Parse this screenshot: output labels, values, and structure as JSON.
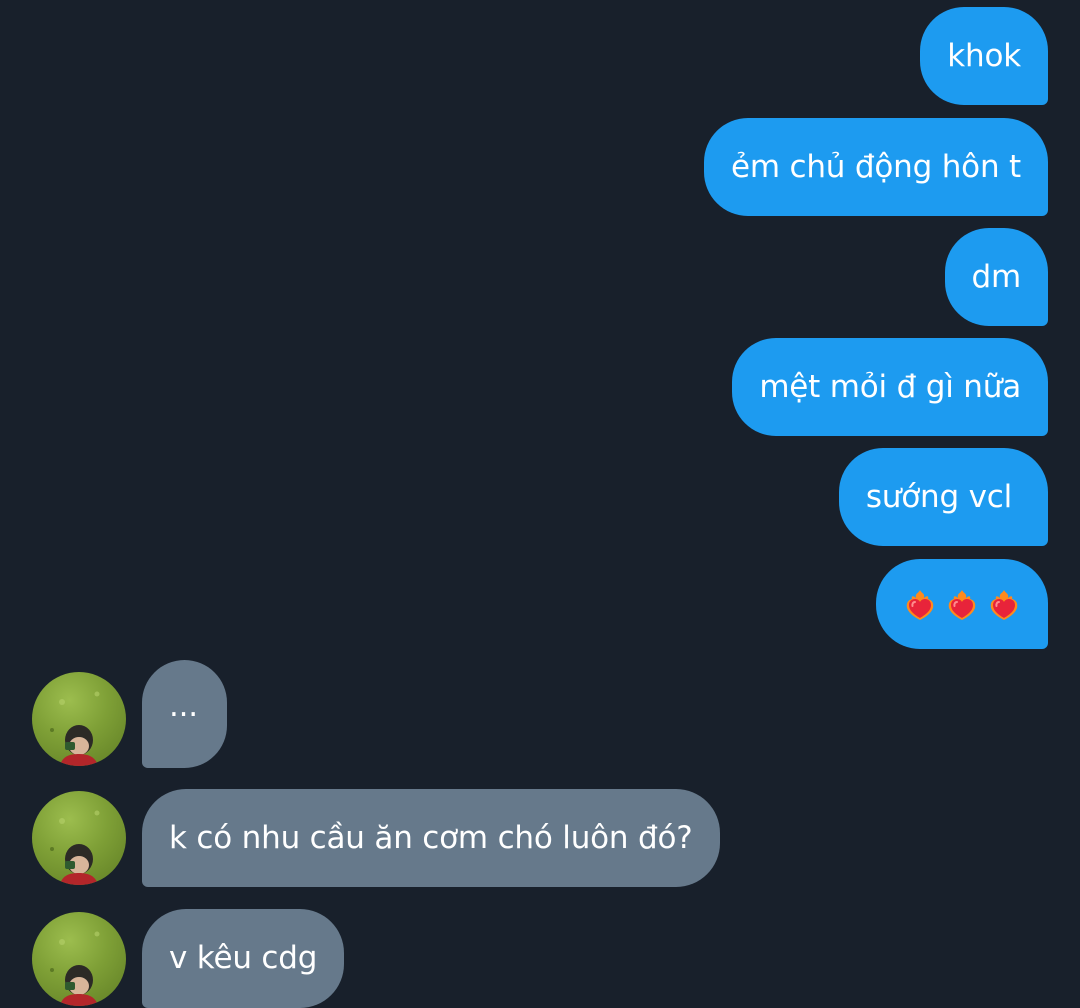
{
  "conversation": {
    "outgoing": [
      {
        "text": "khok"
      },
      {
        "text": "ẻm chủ động hôn t"
      },
      {
        "text": "dm"
      },
      {
        "text": "mệt mỏi đ gì nữa"
      },
      {
        "text": "sướng vcl"
      },
      {
        "emoji": [
          "heart-on-fire",
          "heart-on-fire",
          "heart-on-fire"
        ]
      }
    ],
    "incoming": [
      {
        "text": "..."
      },
      {
        "text": "k có nhu cầu ăn cơm chó luôn đó?"
      },
      {
        "text": "v kêu cdg"
      }
    ]
  },
  "colors": {
    "background": "#18202b",
    "outgoing_bubble": "#1d9bf0",
    "incoming_bubble": "#66798b",
    "text": "#ffffff"
  },
  "icons": {
    "avatar": "profile-photo-avatar",
    "reaction": "heart-on-fire-emoji"
  }
}
